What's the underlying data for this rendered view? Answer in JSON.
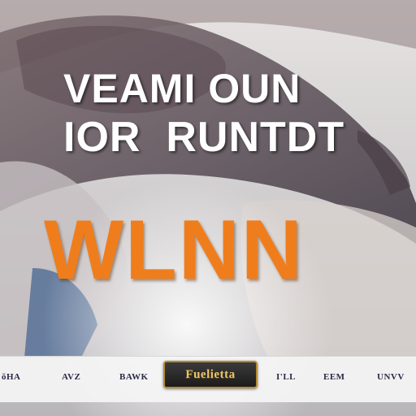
{
  "title": {
    "line1": "VEAMI OUN",
    "line2": "IOR  RUNTDT",
    "headline": "WLNN"
  },
  "bottom_bar": {
    "labels": [
      "ŏHA",
      "AVZ",
      "BAWK",
      "I'LL",
      "EEM",
      "UNVV"
    ],
    "logo_text": "Fuelietta"
  },
  "colors": {
    "headline": "#f07d1c",
    "title_text": "#ffffff",
    "logo_gold": "#e9c46a"
  }
}
